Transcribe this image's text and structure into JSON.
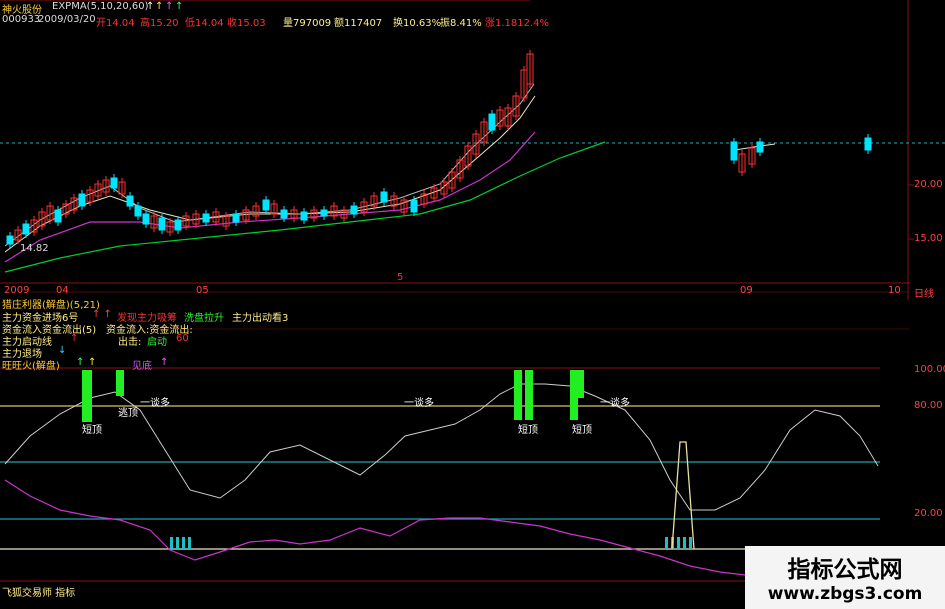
{
  "header": {
    "stock_name": "神火股份",
    "indicator": "EXPMA(5,10,20,60)",
    "arrows": [
      "↑",
      "↑",
      "↑",
      "↑"
    ],
    "code": "000933",
    "date": "2009/03/20",
    "open": "开14.04",
    "high": "高15.20",
    "low": "低14.04",
    "close": "收15.03",
    "volume": "量797009",
    "amount": "额117407",
    "turnover": "换10.63%",
    "amplitude": "振8.41%",
    "change": "涨1.1812.4%"
  },
  "price_axis": {
    "labels": [
      "20.00",
      "15.00"
    ],
    "low_mark": "14.82",
    "marker_5": "5"
  },
  "date_axis": {
    "labels": [
      "2009",
      "04",
      "05",
      "09",
      "10",
      "日线"
    ]
  },
  "mid_panel": {
    "title": "猎庄利器(解盘)(5,21)",
    "line2_a": "主力资金进场6号",
    "line2_arrows": "↑ ↑",
    "line2_b": "发现主力吸筹",
    "line2_c": "洗盘拉升",
    "line2_d": "主力出动看3",
    "line3": "资金流入资金流出(5)",
    "line3_b": "资金流入:资金流出:",
    "line4_a": "主力启动线",
    "line4_arrow": "↑",
    "line4_b": "出击:",
    "line4_c": "启动",
    "line4_d": "60",
    "line5_a": "主力退场",
    "line5_arrow": "↓"
  },
  "lower_panel": {
    "title": "旺旺火(解盘)",
    "title_arrows": [
      "↑",
      "↑"
    ],
    "label_b": "见底",
    "label_b_arrow": "↑",
    "axis": [
      "100.00",
      "80.00",
      "20.00"
    ],
    "labels": {
      "short1": "短顶",
      "short2": "短顶",
      "short3": "短顶",
      "escape": "逃顶",
      "wait1": "一谈多",
      "wait2": "一谈多",
      "wait3": "一谈多"
    }
  },
  "footer": {
    "text": "飞狐交易师 指标"
  },
  "watermark": {
    "line1": "指标公式网",
    "line2": "www.zbgs3.com"
  },
  "colors": {
    "up": "#ff3030",
    "down": "#00e5ff",
    "green": "#00cc33",
    "magenta": "#cc33cc",
    "yellow": "#e8e8a0"
  }
}
